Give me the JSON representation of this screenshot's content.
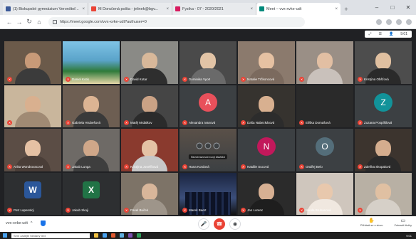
{
  "browser": {
    "tabs": [
      {
        "title": "(1) Biskupské gymnázium Veronštoř...",
        "color": "#3b5998",
        "active": false
      },
      {
        "title": "M Doručená pošta - jelinek@bgv...",
        "color": "#ea4335",
        "active": false
      },
      {
        "title": "Fyzika - 07 - 2020/2021",
        "color": "#d81b60",
        "active": false
      },
      {
        "title": "Meet – vvx-xvke-udt",
        "color": "#00897b",
        "active": true
      }
    ],
    "url": "https://meet.google.com/vvx-xvke-udt?authuser=0",
    "new_tab": "+",
    "window_controls": [
      "–",
      "□",
      "✕"
    ]
  },
  "meet_toolbar": {
    "items": [
      "⤢",
      "☰",
      "👤",
      "9:01"
    ]
  },
  "tiles": [
    {
      "name": "",
      "type": "video",
      "bg": "#6b5a4a",
      "skin": "#c89a78",
      "shirt": "#3b3b3b"
    },
    {
      "name": "Daniel Kotis",
      "type": "scenery",
      "bg": "#5aa3c9"
    },
    {
      "name": "David Kotar",
      "type": "video",
      "bg": "#8a8a86",
      "skin": "#d8b89a",
      "shirt": "#2e2e2e"
    },
    {
      "name": "Dominika Vyort",
      "type": "video",
      "bg": "#4a4a4a",
      "skin": "#e2c4a6",
      "shirt": "#6a6a6a"
    },
    {
      "name": "Natalie Trčkoncová",
      "type": "video",
      "bg": "#8b7a6d",
      "skin": "#e6c1a2",
      "shirt": "#7b6a5e"
    },
    {
      "name": "",
      "type": "video",
      "bg": "#9a8f86",
      "skin": "#e2bfa3",
      "shirt": "#c9c1bb"
    },
    {
      "name": "Kristýna Obšťová",
      "type": "video",
      "bg": "#4d4d4d",
      "skin": "#e0c0a0",
      "shirt": "#2a2a2a"
    },
    {
      "name": "",
      "type": "video",
      "bg": "#c9b69c",
      "skin": "#d9b08f",
      "shirt": "#a08a74"
    },
    {
      "name": "Gabriela Hrubešová",
      "type": "video",
      "bg": "#6d5e52",
      "skin": "#dcb493",
      "shirt": "#3a3a3a"
    },
    {
      "name": "Matěj Mrdalkov",
      "type": "video",
      "bg": "#454545",
      "skin": "#caa285",
      "shirt": "#2b2b2b"
    },
    {
      "name": "Alexandra Ivanová",
      "type": "avatar",
      "letter": "A",
      "color": "#e8505b"
    },
    {
      "name": "Daša Nabezkárová",
      "type": "video",
      "bg": "#36332f",
      "skin": "#d8b090",
      "shirt": "#2c2c2c"
    },
    {
      "name": "Eliška Domašová",
      "type": "dark",
      "bg": "#2a2a2a"
    },
    {
      "name": "Zuzana Pospíšilová",
      "type": "avatar",
      "letter": "Z",
      "color": "#12939a"
    },
    {
      "name": "Arika Wondrovacová",
      "type": "video",
      "bg": "#5b4d45",
      "skin": "#e5c1a4",
      "shirt": "#4a3e38"
    },
    {
      "name": "Jakub Lunga",
      "type": "video",
      "bg": "#6e6a66",
      "skin": "#cfa789",
      "shirt": "#3e3e3e"
    },
    {
      "name": "Kristýna Josefíková",
      "type": "video",
      "bg": "#8a3a2e",
      "skin": "#e4c2a5",
      "shirt": "#c7c7c7"
    },
    {
      "name": "Hana Kordová",
      "type": "controls",
      "bg": "#3c4043",
      "caption": "Nezobrazovat svoji dlaždici"
    },
    {
      "name": "Natálie Sucová",
      "type": "avatar",
      "letter": "N",
      "color": "#c2185b"
    },
    {
      "name": "Ondřej Belo",
      "type": "avatar",
      "letter": "O",
      "color": "#546e7a"
    },
    {
      "name": "Zdeňka Skopalová",
      "type": "video",
      "bg": "#3c342e",
      "skin": "#d4ad8e",
      "shirt": "#2a2a2a"
    },
    {
      "name": "Petr Lapenský",
      "type": "office",
      "letter": "W",
      "color": "#2b579a"
    },
    {
      "name": "Jakub Skoji",
      "type": "office",
      "letter": "X",
      "color": "#217346"
    },
    {
      "name": "Pavel Buček",
      "type": "video",
      "bg": "#7d7367",
      "skin": "#d8b69a",
      "shirt": "#9e958a"
    },
    {
      "name": "Marek Baert",
      "type": "city",
      "bg": "#3b4e7a"
    },
    {
      "name": "Jan Lorenc",
      "type": "video",
      "bg": "#2b2b2b",
      "skin": "#d7b093",
      "shirt": "#1e1e1e"
    },
    {
      "name": "Nikola Bruhanová",
      "type": "video",
      "bg": "#cfc6bd",
      "skin": "#e8c8ad",
      "shirt": "#f0e8e0"
    },
    {
      "name": "",
      "type": "video",
      "bg": "#b8b0a4",
      "skin": "#e0c0a2",
      "shirt": "#d6d0c8"
    }
  ],
  "bottom_bar": {
    "meeting_code": "vvx-xvke-udt",
    "chevron": "^",
    "mic_icon": "🎤",
    "hangup_icon": "☎",
    "camera_icon": "◉",
    "present_label": "Přihlásit se o slovo",
    "present_icon": "✋",
    "captions_label": "Zobrazit titulky",
    "captions_icon": "▭"
  },
  "taskbar": {
    "search_placeholder": "Sem zadejte hledaný text",
    "icons": [
      "#f0c040",
      "#4aa3f0",
      "#e05a30",
      "#5fb0e0",
      "#7a4fb0",
      "#2f9e5a"
    ],
    "clock": "9:01"
  }
}
